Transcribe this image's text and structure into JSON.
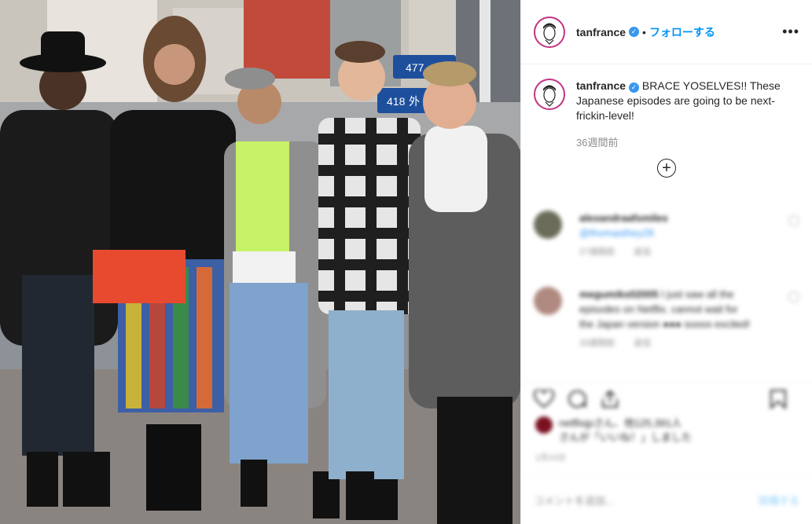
{
  "post": {
    "username": "tanfrance",
    "separator": "•",
    "follow_label": "フォローする",
    "more_label": "•••",
    "caption_username": "tanfrance",
    "caption_text": "BRACE YOSELVES!! These Japanese episodes are going to be next-frickin-level!",
    "time_ago": "36週間前",
    "load_more_label": "+"
  },
  "comments": [
    {
      "username": "alexandraafsmiles",
      "text": "@thomasthey28",
      "meta_time": "27週間前",
      "meta_reply": "返信",
      "avatar_color": "#6b6b5a"
    },
    {
      "username": "megumiks02005",
      "text": "I just saw all the episodes on Netflix. cannot wait for the Japan version ●●● soooo excited!",
      "meta_time": "33週間前",
      "meta_reply": "返信",
      "avatar_color": "#b08a80"
    }
  ],
  "likes": {
    "text_line1": "netflixjpさん、他125,391人",
    "text_line2": "さんが「いいね！」しました"
  },
  "date": "1月20日",
  "add_comment": {
    "placeholder": "コメントを追加...",
    "post_label": "投稿する"
  },
  "photo": {
    "signs": [
      "477",
      "418",
      "外"
    ]
  },
  "colors": {
    "accent": "#0095f6",
    "verified": "#3897f0",
    "story_ring": "#c13584"
  }
}
